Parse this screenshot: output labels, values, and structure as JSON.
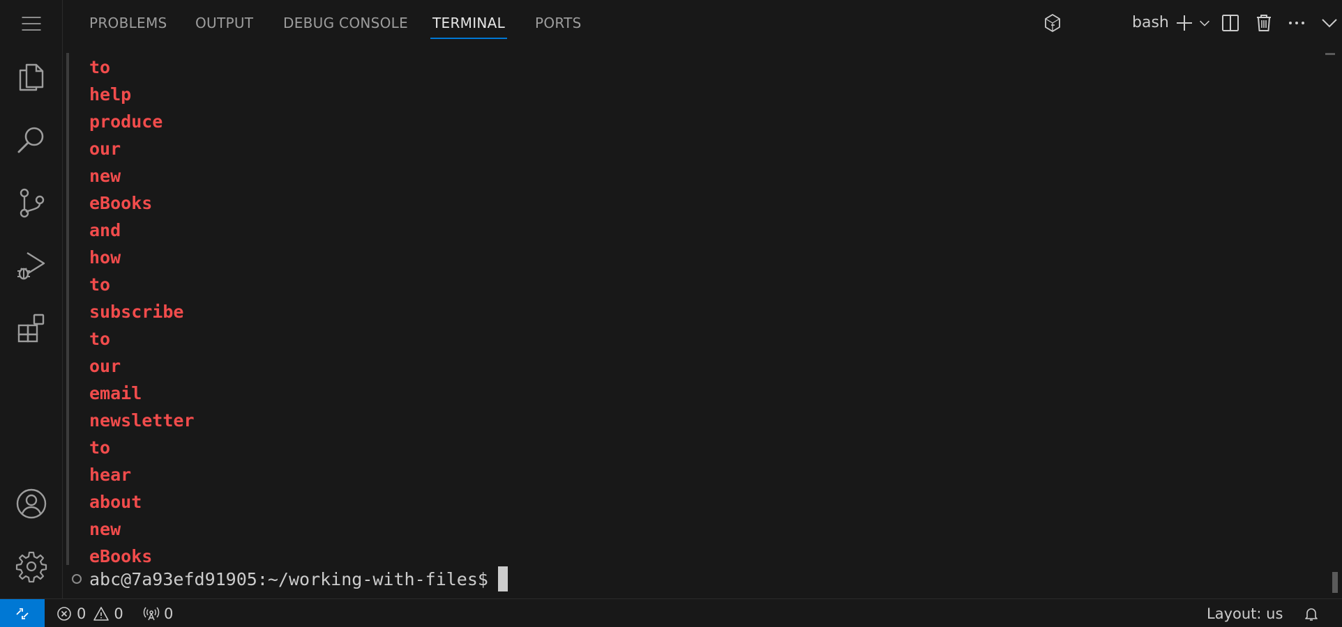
{
  "activity_bar": {
    "icons": [
      "menu-icon",
      "explorer-icon",
      "search-icon",
      "source-control-icon",
      "run-debug-icon",
      "extensions-icon",
      "account-icon",
      "settings-gear-icon"
    ]
  },
  "panel": {
    "tabs": [
      {
        "label": "PROBLEMS",
        "active": false
      },
      {
        "label": "OUTPUT",
        "active": false
      },
      {
        "label": "DEBUG CONSOLE",
        "active": false
      },
      {
        "label": "TERMINAL",
        "active": true
      },
      {
        "label": "PORTS",
        "active": false
      }
    ],
    "terminal_profile": "bash"
  },
  "terminal": {
    "output_lines": [
      "to",
      "help",
      "produce",
      "our",
      "new",
      "eBooks",
      "and",
      "how",
      "to",
      "subscribe",
      "to",
      "our",
      "email",
      "newsletter",
      "to",
      "hear",
      "about",
      "new",
      "eBooks"
    ],
    "output_color": "#f14c4c",
    "prompt": "abc@7a93efd91905:~/working-with-files$"
  },
  "status_bar": {
    "errors": "0",
    "warnings": "0",
    "ports": "0",
    "layout": "Layout: us",
    "remote_color": "#0078d4"
  }
}
